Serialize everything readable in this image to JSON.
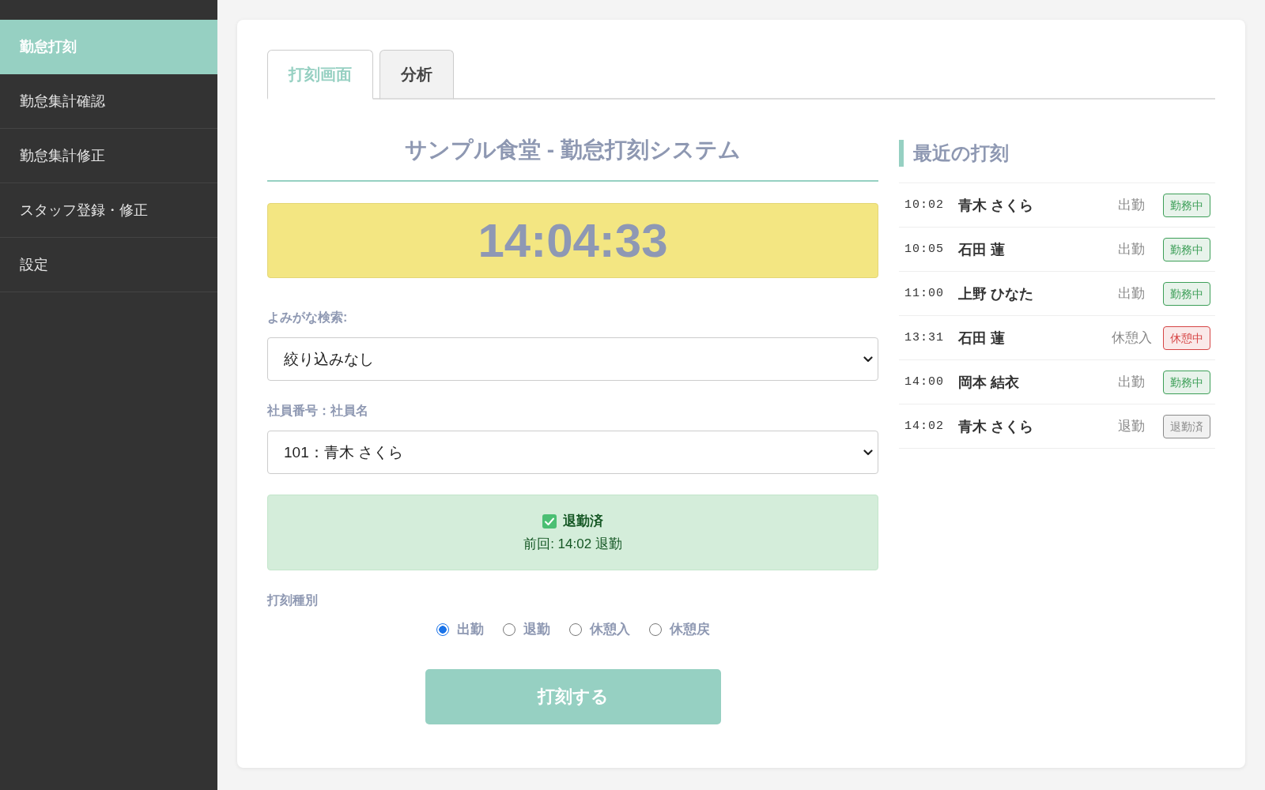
{
  "sidebar": {
    "items": [
      {
        "label": "勤怠打刻",
        "selected": true
      },
      {
        "label": "勤怠集計確認",
        "selected": false
      },
      {
        "label": "勤怠集計修正",
        "selected": false
      },
      {
        "label": "スタッフ登録・修正",
        "selected": false
      },
      {
        "label": "設定",
        "selected": false
      }
    ]
  },
  "tabs": [
    {
      "label": "打刻画面",
      "selected": true
    },
    {
      "label": "分析",
      "selected": false
    }
  ],
  "punch": {
    "title": "サンプル食堂 - 勤怠打刻システム",
    "clock": "14:04:33",
    "kana_search": {
      "label": "よみがな検索:",
      "value": "絞り込みなし"
    },
    "employee": {
      "label": "社員番号：社員名",
      "value": "101：青木 さくら"
    },
    "status": {
      "title": "退勤済",
      "detail": "前回: 14:02 退勤"
    },
    "punch_type": {
      "label": "打刻種別",
      "options": [
        {
          "label": "出勤",
          "selected": true
        },
        {
          "label": "退勤",
          "selected": false
        },
        {
          "label": "休憩入",
          "selected": false
        },
        {
          "label": "休憩戻",
          "selected": false
        }
      ]
    },
    "submit_button": "打刻する"
  },
  "recent": {
    "title": "最近の打刻",
    "rows": [
      {
        "time": "10:02",
        "name": "青木 さくら",
        "type": "出勤",
        "status": "勤務中",
        "color": "#3d9f58"
      },
      {
        "time": "10:05",
        "name": "石田 蓮",
        "type": "出勤",
        "status": "勤務中",
        "color": "#3d9f58"
      },
      {
        "time": "11:00",
        "name": "上野 ひなた",
        "type": "出勤",
        "status": "勤務中",
        "color": "#3d9f58"
      },
      {
        "time": "13:31",
        "name": "石田 蓮",
        "type": "休憩入",
        "status": "休憩中",
        "color": "#d64545"
      },
      {
        "time": "14:00",
        "name": "岡本 結衣",
        "type": "出勤",
        "status": "勤務中",
        "color": "#3d9f58"
      },
      {
        "time": "14:02",
        "name": "青木 さくら",
        "type": "退勤",
        "status": "退勤済",
        "color": "#8a8a8a"
      }
    ]
  }
}
